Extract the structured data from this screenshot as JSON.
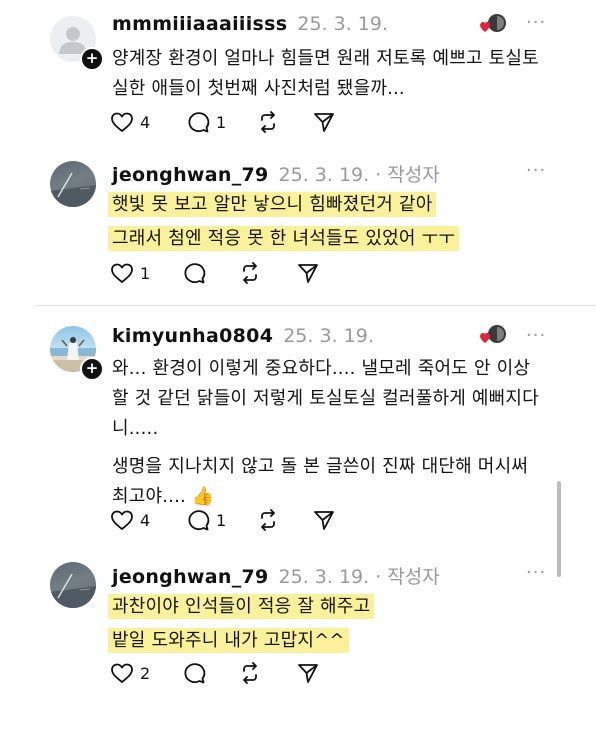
{
  "posts": [
    {
      "username": "mmmiiiaaaiiisss",
      "date": "25. 3. 19.",
      "author_tag": "",
      "lines": [
        "양계장 환경이 얼마나 힘들면 원래 저토록 예쁘고 토실토",
        "실한 애들이 첫번째 사진처럼 됐을까..."
      ],
      "likes": "4",
      "replies": "1",
      "highlight": false,
      "avatar": "default-person-avatar"
    },
    {
      "username": "jeonghwan_79",
      "date": "25. 3. 19.",
      "author_tag": "· 작성자",
      "lines": [
        "햇빛 못 보고 알만 낳으니 힘빠졌던거 같아",
        "그래서 첨엔 적응 못 한 녀석들도 있었어 ㅜㅜ"
      ],
      "likes": "1",
      "replies": "",
      "highlight": true,
      "avatar": "field-photo-avatar"
    },
    {
      "username": "kimyunha0804",
      "date": "25. 3. 19.",
      "author_tag": "",
      "lines": [
        "와... 환경이 이렇게 중요하다.... 낼모레 죽어도 안 이상",
        "할 것 같던 닭들이 저렇게 토실토실 컬러풀하게 예뻐지다",
        "니.....",
        "생명을 지나치지 않고 돌 본 글쓴이 진짜 대단해 머시써",
        "최고야.... 👍"
      ],
      "likes": "4",
      "replies": "1",
      "highlight": false,
      "avatar": "beach-photo-avatar"
    },
    {
      "username": "jeonghwan_79",
      "date": "25. 3. 19.",
      "author_tag": "· 작성자",
      "lines": [
        "과찬이야 인석들이 적응 잘 해주고",
        "밭일 도와주니 내가 고맙지^^"
      ],
      "likes": "2",
      "replies": "",
      "highlight": true,
      "avatar": "field-photo-avatar"
    }
  ],
  "icons": {
    "like": "heart-outline-icon",
    "reply": "comment-bubble-icon",
    "repost": "repost-icon",
    "share": "send-icon",
    "more": "more-dots-icon",
    "badge": "heart-reaction-badge"
  },
  "colors": {
    "highlight": "#fbf19a",
    "muted": "#9a9a9a",
    "heart_red": "#e0243c"
  },
  "more_label": "···"
}
